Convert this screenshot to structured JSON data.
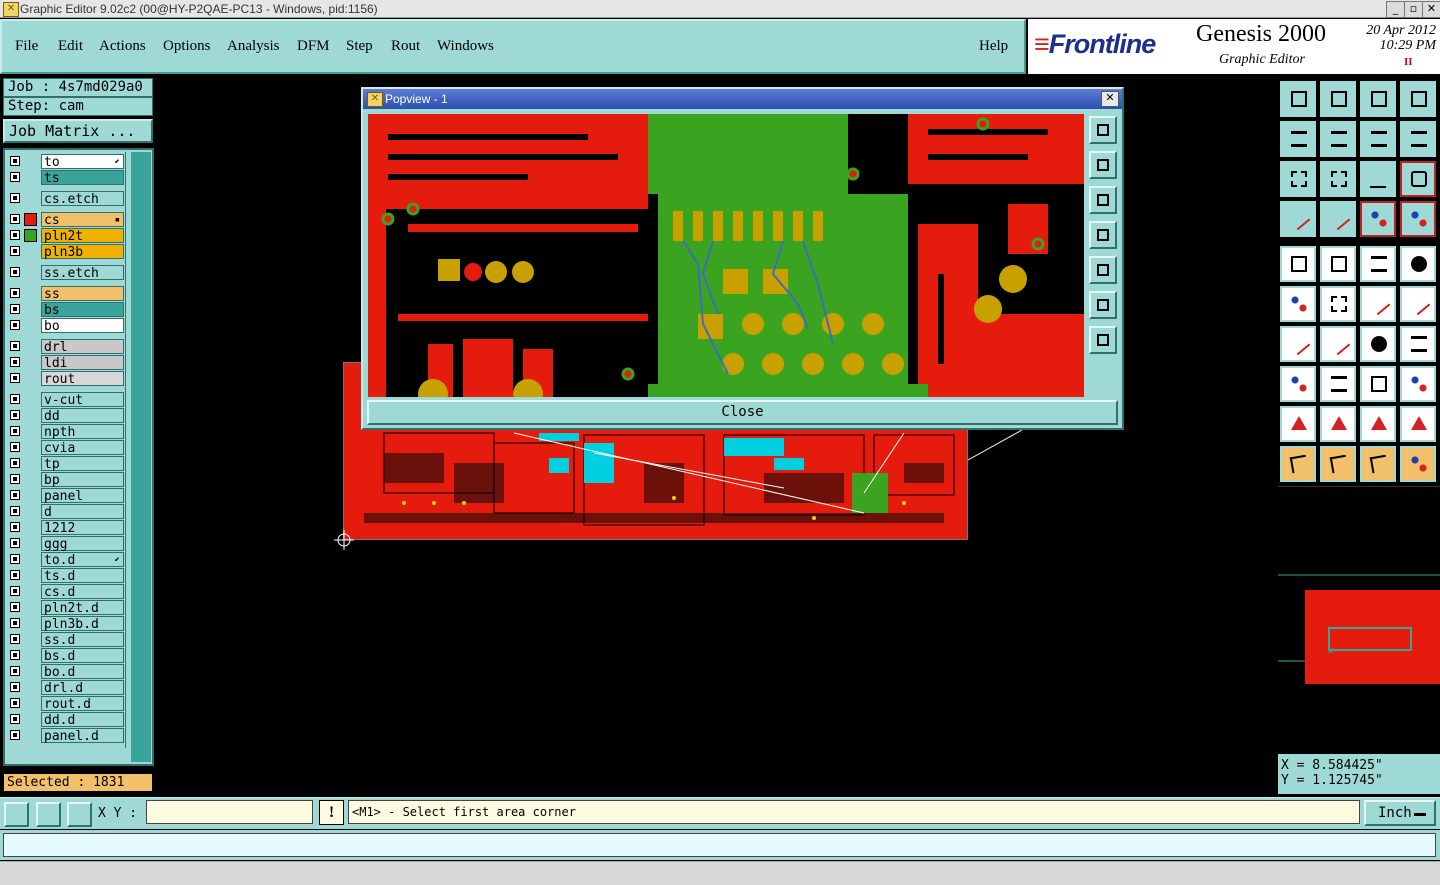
{
  "window": {
    "title": "Graphic Editor 9.02c2 (00@HY-P2QAE-PC13 - Windows, pid:1156)",
    "minimize": "_",
    "maximize": "▫",
    "close": "✕"
  },
  "menu": {
    "items": [
      "File",
      "Edit",
      "Actions",
      "Options",
      "Analysis",
      "DFM",
      "Step",
      "Rout",
      "Windows"
    ],
    "help": "Help"
  },
  "brand": {
    "logo_a": "≡",
    "logo_b": "Frontline",
    "product": "Genesis 2000",
    "subtitle": "Graphic Editor",
    "date": "20 Apr 2012",
    "time": "10:29 PM",
    "pause": "II"
  },
  "job": {
    "job_label": "Job : 4s7md029a0",
    "step_label": "Step: cam",
    "matrix_button": "Job Matrix ..."
  },
  "layers": [
    {
      "name": "to",
      "color": "#ffffff",
      "mark": "⬋"
    },
    {
      "name": "ts",
      "color": "#3aa39a"
    },
    {
      "name": "cs.etch",
      "color": "#9fd9d6"
    },
    {
      "name": "cs",
      "color": "#f2c068",
      "mark": "▪",
      "active": true
    },
    {
      "name": "pln2t",
      "color": "#f0b000",
      "swatch": "#3aa320"
    },
    {
      "name": "pln3b",
      "color": "#f0b000"
    },
    {
      "name": "ss.etch",
      "color": "#9fd9d6"
    },
    {
      "name": "ss",
      "color": "#f2c068"
    },
    {
      "name": "bs",
      "color": "#3aa39a"
    },
    {
      "name": "bo",
      "color": "#ffffff"
    },
    {
      "name": "drl",
      "color": "#c8c8c8"
    },
    {
      "name": "ldi",
      "color": "#c8c8c8"
    },
    {
      "name": "rout",
      "color": "#d8d8d8"
    },
    {
      "name": "v-cut",
      "color": "#9fd9d6"
    },
    {
      "name": "dd",
      "color": "#9fd9d6"
    },
    {
      "name": "npth",
      "color": "#9fd9d6"
    },
    {
      "name": "cvia",
      "color": "#9fd9d6"
    },
    {
      "name": "tp",
      "color": "#9fd9d6"
    },
    {
      "name": "bp",
      "color": "#9fd9d6"
    },
    {
      "name": "panel",
      "color": "#9fd9d6"
    },
    {
      "name": "d",
      "color": "#9fd9d6"
    },
    {
      "name": "1212",
      "color": "#9fd9d6"
    },
    {
      "name": "ggg",
      "color": "#9fd9d6"
    },
    {
      "name": "to.d",
      "color": "#9fd9d6",
      "mark": "⬋"
    },
    {
      "name": "ts.d",
      "color": "#9fd9d6"
    },
    {
      "name": "cs.d",
      "color": "#9fd9d6"
    },
    {
      "name": "pln2t.d",
      "color": "#9fd9d6"
    },
    {
      "name": "pln3b.d",
      "color": "#9fd9d6"
    },
    {
      "name": "ss.d",
      "color": "#9fd9d6"
    },
    {
      "name": "bs.d",
      "color": "#9fd9d6"
    },
    {
      "name": "bo.d",
      "color": "#9fd9d6"
    },
    {
      "name": "drl.d",
      "color": "#9fd9d6"
    },
    {
      "name": "rout.d",
      "color": "#9fd9d6"
    },
    {
      "name": "dd.d",
      "color": "#9fd9d6"
    },
    {
      "name": "panel.d",
      "color": "#9fd9d6"
    }
  ],
  "selected": "Selected : 1831",
  "popview": {
    "title": "Popview - 1",
    "close_button": "Close",
    "close_x": "✕"
  },
  "coords": {
    "x": "X = 8.584425\"",
    "y": "Y = 1.125745\""
  },
  "bottom": {
    "xy_label": "X Y :",
    "xy_value": "",
    "alert": "!",
    "status": "<M1> - Select first area corner",
    "units": "Inch"
  },
  "tools": [
    "open-step-icon",
    "close-step-icon",
    "home-icon",
    "panel-icon",
    "pan-left-icon",
    "pan-right-icon",
    "zoom-back-icon",
    "zoom-sync-icon",
    "zoom-fit-icon",
    "zoom-center-icon",
    "zoom-1to2-icon",
    "help-icon",
    "measure-icon",
    "snap-icon",
    "layer-compare-icon",
    "layer-select-icon",
    "add-pad-icon",
    "add-line-icon",
    "ruler-icon",
    "circle-icon",
    "connect-icon",
    "cross-icon",
    "move-icon",
    "move-point-icon",
    "angle-icon",
    "slash-icon",
    "arc-icon",
    "flip-icon",
    "surface-icon",
    "minus-icon",
    "resize-icon",
    "shapes-icon",
    "triangle-icon",
    "arch-icon",
    "arch-bar-icon",
    "arch-line-icon",
    "pointer-icon",
    "select-icon",
    "select-area-icon",
    "net-icon"
  ]
}
